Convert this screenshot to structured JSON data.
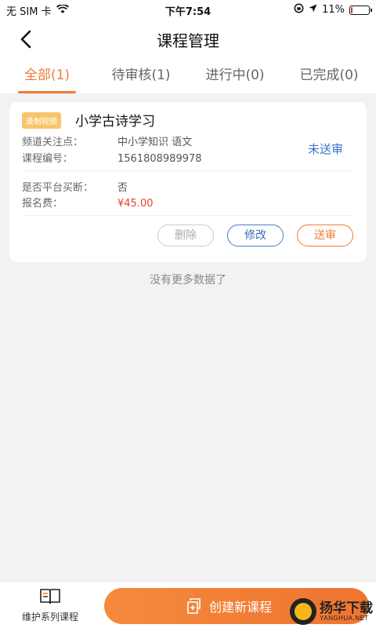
{
  "status_bar": {
    "carrier": "无 SIM 卡",
    "time": "下午7:54",
    "battery": "11%",
    "battery_level": 0.11
  },
  "nav": {
    "title": "课程管理"
  },
  "tabs": [
    {
      "label": "全部(1)",
      "active": true
    },
    {
      "label": "待审核(1)",
      "active": false
    },
    {
      "label": "进行中(0)",
      "active": false
    },
    {
      "label": "已完成(0)",
      "active": false
    }
  ],
  "course": {
    "badge": "录制视频",
    "title": "小学古诗学习",
    "channel_label": "频道关注点：",
    "channel_value": "中小学知识 语文",
    "code_label": "课程编号：",
    "code_value": "1561808989978",
    "status": "未送审",
    "buyout_label": "是否平台买断：",
    "buyout_value": "否",
    "fee_label": "报名费：",
    "fee_value": "¥45.00",
    "buttons": {
      "delete": "删除",
      "edit": "修改",
      "submit": "送审"
    }
  },
  "list_footer": "没有更多数据了",
  "bottom": {
    "maintain_label": "维护系列课程",
    "create_label": "创建新课程"
  },
  "watermark": {
    "cn": "扬华下载",
    "en": "YANGHUA.NET"
  },
  "colors": {
    "accent": "#f07c33",
    "link": "#3a74c9",
    "price": "#e0442a",
    "badge": "#f8c56c"
  }
}
